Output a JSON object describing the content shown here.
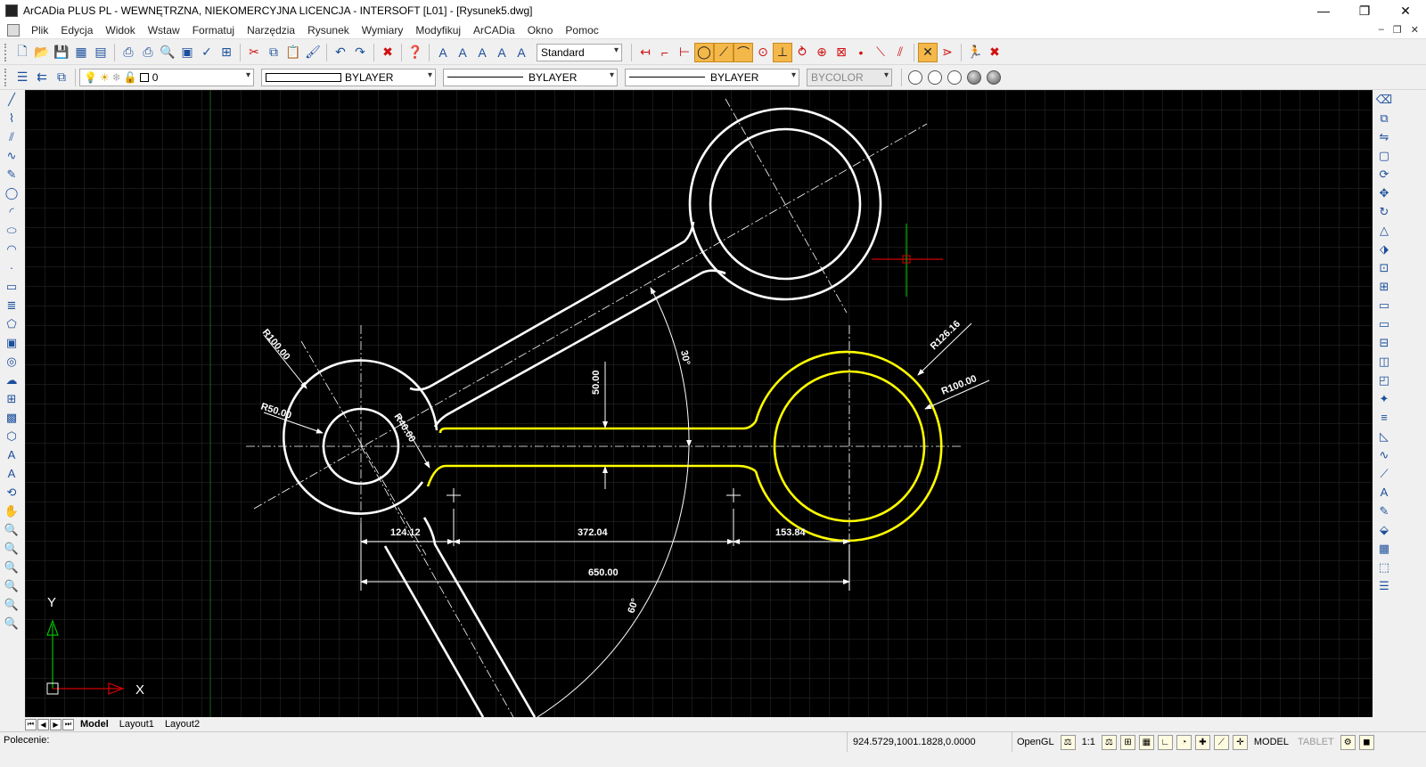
{
  "window": {
    "title": "ArCADia PLUS PL - WEWNĘTRZNA, NIEKOMERCYJNA LICENCJA - INTERSOFT [L01] - [Rysunek5.dwg]",
    "min_glyph": "—",
    "max_glyph": "❐",
    "close_glyph": "✕"
  },
  "menu": {
    "items": [
      "Plik",
      "Edycja",
      "Widok",
      "Wstaw",
      "Formatuj",
      "Narzędzia",
      "Rysunek",
      "Wymiary",
      "Modyfikuj",
      "ArCADia",
      "Okno",
      "Pomoc"
    ],
    "mdi_min": "–",
    "mdi_restore": "❐",
    "mdi_close": "✕"
  },
  "toolbar1": {
    "text_style_value": "Standard"
  },
  "toolbar2": {
    "layer_value": "0",
    "color_value": "BYLAYER",
    "linetype_value": "BYLAYER",
    "lineweight_value": "BYLAYER",
    "plotstyle_value": "BYCOLOR"
  },
  "colors": {
    "canvas": "#000000",
    "grid": "#2e2e2e",
    "geometry": "#ffffff",
    "selected": "#ffff00",
    "cursor_x": "#d40000",
    "cursor_y": "#00b000"
  },
  "drawing": {
    "dimensions": {
      "d_124": "124.12",
      "d_372": "372.04",
      "d_153": "153.84",
      "d_650": "650.00",
      "d_50": "50.00",
      "angle_30": "30°",
      "angle_60": "60°",
      "r100_left": "R100.00",
      "r50": "R50.00",
      "r40": "R40.00",
      "r126": "R126.16",
      "r100_right": "R100.00"
    },
    "ucs": {
      "x_label": "X",
      "y_label": "Y"
    }
  },
  "tabs": {
    "items": [
      "Model",
      "Layout1",
      "Layout2"
    ],
    "active": "Model"
  },
  "command": {
    "prompt": "Polecenie:"
  },
  "status": {
    "coordinates": "924.5729,1001.1828,0.0000",
    "renderer": "OpenGL",
    "scale": "1:1",
    "space": "MODEL",
    "tablet": "TABLET"
  }
}
